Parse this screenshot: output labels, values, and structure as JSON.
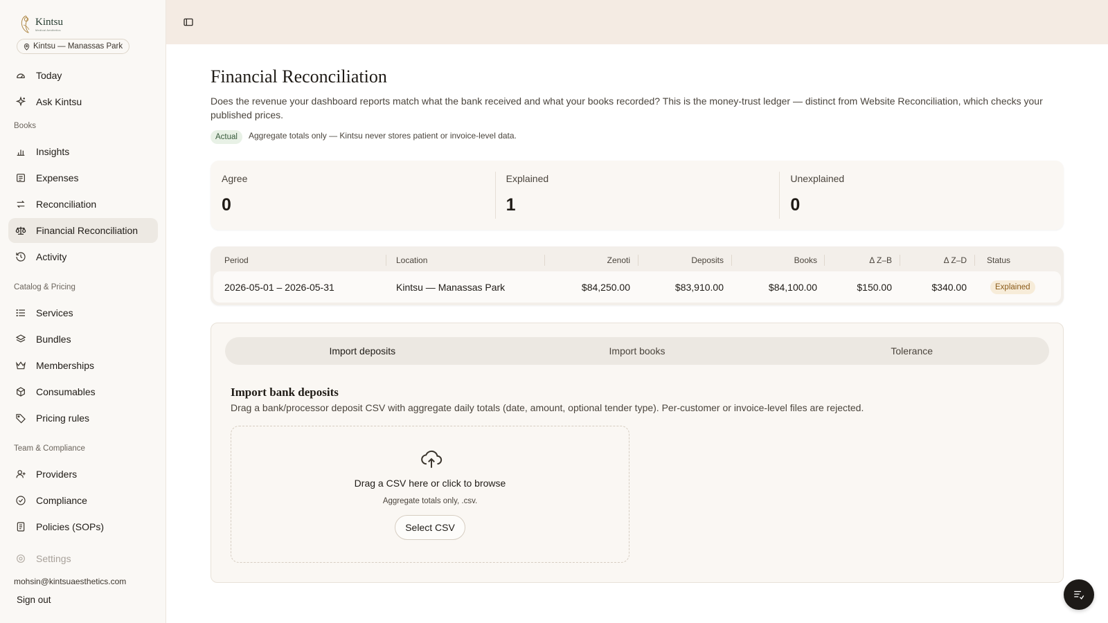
{
  "brand": {
    "name": "Kintsu",
    "tagline": "Medical Aesthetics"
  },
  "location": {
    "label": "Kintsu — Manassas Park"
  },
  "sidebar": {
    "top_items": [
      {
        "label": "Today",
        "icon": "gauge-icon"
      },
      {
        "label": "Ask Kintsu",
        "icon": "sparkle-icon"
      }
    ],
    "sections": [
      {
        "title": "Books",
        "items": [
          {
            "label": "Insights",
            "icon": "bar-chart-icon"
          },
          {
            "label": "Expenses",
            "icon": "receipt-icon"
          },
          {
            "label": "Reconciliation",
            "icon": "arrows-swap-icon"
          },
          {
            "label": "Financial Reconciliation",
            "icon": "scale-icon",
            "active": true
          },
          {
            "label": "Activity",
            "icon": "history-icon"
          }
        ]
      },
      {
        "title": "Catalog & Pricing",
        "items": [
          {
            "label": "Services",
            "icon": "list-icon"
          },
          {
            "label": "Bundles",
            "icon": "layers-icon"
          },
          {
            "label": "Memberships",
            "icon": "crown-icon"
          },
          {
            "label": "Consumables",
            "icon": "package-icon"
          },
          {
            "label": "Pricing rules",
            "icon": "tag-icon"
          }
        ]
      },
      {
        "title": "Team & Compliance",
        "items": [
          {
            "label": "Providers",
            "icon": "user-plus-icon"
          },
          {
            "label": "Compliance",
            "icon": "badge-check-icon"
          },
          {
            "label": "Policies (SOPs)",
            "icon": "document-icon"
          }
        ]
      }
    ],
    "settings_label": "Settings",
    "user_email": "mohsin@kintsuaesthetics.com",
    "sign_out": "Sign out"
  },
  "page": {
    "title": "Financial Reconciliation",
    "description": "Does the revenue your dashboard reports match what the bank received and what your books recorded? This is the money-trust ledger — distinct from Website Reconciliation, which checks your published prices.",
    "badge": "Actual",
    "note": "Aggregate totals only — Kintsu never stores patient or invoice-level data."
  },
  "stats": [
    {
      "label": "Agree",
      "value": "0"
    },
    {
      "label": "Explained",
      "value": "1"
    },
    {
      "label": "Unexplained",
      "value": "0"
    }
  ],
  "table": {
    "headers": [
      "Period",
      "Location",
      "Zenoti",
      "Deposits",
      "Books",
      "Δ Z–B",
      "Δ Z–D",
      "Status"
    ],
    "rows": [
      {
        "period": "2026-05-01 – 2026-05-31",
        "location": "Kintsu — Manassas Park",
        "zenoti": "$84,250.00",
        "deposits": "$83,910.00",
        "books": "$84,100.00",
        "dzb": "$150.00",
        "dzd": "$340.00",
        "status": "Explained"
      }
    ]
  },
  "import": {
    "tabs": [
      "Import deposits",
      "Import books",
      "Tolerance"
    ],
    "active_tab": "Import deposits",
    "title": "Import bank deposits",
    "description": "Drag a bank/processor deposit CSV with aggregate daily totals (date, amount, optional tender type). Per-customer or invoice-level files are rejected.",
    "dropzone_title": "Drag a CSV here or click to browse",
    "dropzone_sub": "Aggregate totals only, .csv.",
    "button": "Select CSV"
  },
  "colors": {
    "topbar": "#f4ebe3",
    "sidebar": "#faf8f5",
    "active_nav": "#ede9e3",
    "status_explained": "#8a5a18",
    "badge_actual": "#365a3a"
  }
}
